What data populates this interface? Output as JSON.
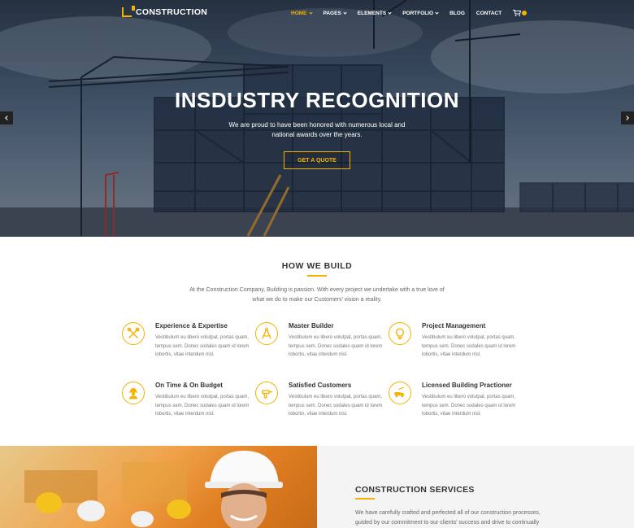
{
  "brand": {
    "name": "CONSTRUCTION",
    "accent": "#f6b200"
  },
  "nav": {
    "items": [
      {
        "label": "HOME",
        "dropdown": true,
        "active": true
      },
      {
        "label": "PAGES",
        "dropdown": true
      },
      {
        "label": "ELEMENTS",
        "dropdown": true
      },
      {
        "label": "PORTFOLIO",
        "dropdown": true
      },
      {
        "label": "BLOG",
        "dropdown": false
      },
      {
        "label": "CONTACT",
        "dropdown": false
      }
    ],
    "cart_icon": "cart-icon"
  },
  "hero": {
    "title": "INSDUSTRY RECOGNITION",
    "subtitle": "We are proud to have been honored with numerous local and national awards over the years.",
    "button": "GET A QUOTE"
  },
  "how_we_build": {
    "title": "HOW WE BUILD",
    "intro": "At the Construction Company, Building is passion. With every project we undertake with a true love of what we do to make our Customers' vision a reality.",
    "features": [
      {
        "title": "Experience & Expertise",
        "icon": "tools-icon",
        "text": "Vestibulum eu libero volutpat, portas quam, tempus sem. Donec sodales quam id lorem lobortis, vitae interdum nisl."
      },
      {
        "title": "Master Builder",
        "icon": "compass-icon",
        "text": "Vestibulum eu libero volutpat, portas quam, tempus sem. Donec sodales quam id lorem lobortis, vitae interdum nisl."
      },
      {
        "title": "Project Management",
        "icon": "lightbulb-icon",
        "text": "Vestibulum eu libero volutpat, portas quam, tempus sem. Donec sodales quam id lorem lobortis, vitae interdum nisl."
      },
      {
        "title": "On Time & On Budget",
        "icon": "worker-icon",
        "text": "Vestibulum eu libero volutpat, portas quam, tempus sem. Donec sodales quam id lorem lobortis, vitae interdum nisl."
      },
      {
        "title": "Satisfied Customers",
        "icon": "drill-icon",
        "text": "Vestibulum eu libero volutpat, portas quam, tempus sem. Donec sodales quam id lorem lobortis, vitae interdum nisl."
      },
      {
        "title": "Licensed Building Practioner",
        "icon": "truck-icon",
        "text": "Vestibulum eu libero volutpat, portas quam, tempus sem. Donec sodales quam id lorem lobortis, vitae interdum nisl."
      }
    ]
  },
  "services": {
    "title": "CONSTRUCTION SERVICES",
    "text": "We have carefully crafted and perfected all of our construction processes, guided by our commitment to our clients' success and drive to continually"
  }
}
